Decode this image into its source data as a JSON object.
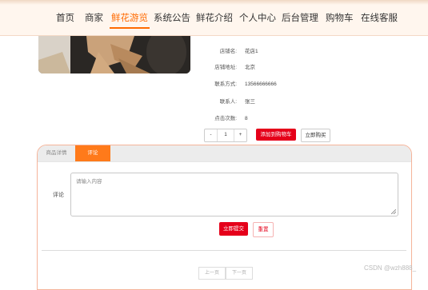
{
  "nav": {
    "items": [
      {
        "label": "首页"
      },
      {
        "label": "商家"
      },
      {
        "label": "鲜花游览",
        "active": true
      },
      {
        "label": "系统公告"
      },
      {
        "label": "鲜花介绍"
      },
      {
        "label": "个人中心"
      },
      {
        "label": "后台管理"
      },
      {
        "label": "购物车"
      },
      {
        "label": "在线客服"
      }
    ]
  },
  "product": {
    "info": [
      {
        "label": "店铺名:",
        "value": "花店1"
      },
      {
        "label": "店铺地址:",
        "value": "北京"
      },
      {
        "label": "联系方式:",
        "value": "13566666666"
      },
      {
        "label": "联系人:",
        "value": "张三"
      },
      {
        "label": "点击次数:",
        "value": "8"
      }
    ],
    "quantity": "1",
    "decrement": "-",
    "increment": "+",
    "add_to_cart": "添加到购物车",
    "buy_now": "立即购买"
  },
  "tabs": {
    "detail": "商品详情",
    "comments": "评论"
  },
  "comment": {
    "label": "评论",
    "placeholder": "请输入内容",
    "submit": "立即提交",
    "reset": "重置"
  },
  "pager": {
    "prev": "上一页",
    "next": "下一页"
  },
  "watermark": "CSDN @wzh888_",
  "colors": {
    "accent": "#ff6a00",
    "primary_button": "#e5001a",
    "tab_active": "#ff7a1a",
    "panel_border": "#f5b49a"
  }
}
